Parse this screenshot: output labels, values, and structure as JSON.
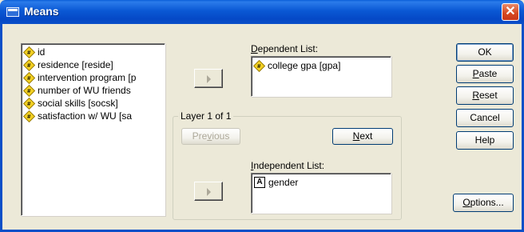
{
  "window": {
    "title": "Means",
    "close_label": "✕"
  },
  "source_list": {
    "items": [
      {
        "label": "id",
        "icon": "scale-variable-icon"
      },
      {
        "label": "residence [reside]",
        "icon": "scale-variable-icon"
      },
      {
        "label": "intervention program [p",
        "icon": "scale-variable-icon"
      },
      {
        "label": "number of WU friends",
        "icon": "scale-variable-icon"
      },
      {
        "label": "social skills [socsk]",
        "icon": "scale-variable-icon"
      },
      {
        "label": "satisfaction w/ WU [sa",
        "icon": "scale-variable-icon"
      }
    ]
  },
  "dependent": {
    "label_u": "D",
    "label_rest": "ependent List:",
    "items": [
      {
        "label": "college gpa [gpa]",
        "icon": "scale-variable-icon"
      }
    ]
  },
  "layer": {
    "legend": "Layer 1 of 1",
    "previous_pre": "Pre",
    "previous_u": "v",
    "previous_post": "ious",
    "next_u": "N",
    "next_rest": "ext"
  },
  "independent": {
    "label_u": "I",
    "label_rest": "ndependent List:",
    "items": [
      {
        "label": "gender",
        "icon": "nominal-variable-icon",
        "glyph": "A"
      }
    ]
  },
  "buttons": {
    "ok": "OK",
    "paste_u": "P",
    "paste_rest": "aste",
    "reset_u": "R",
    "reset_rest": "eset",
    "cancel": "Cancel",
    "help": "Help",
    "options_u": "O",
    "options_rest": "ptions..."
  }
}
